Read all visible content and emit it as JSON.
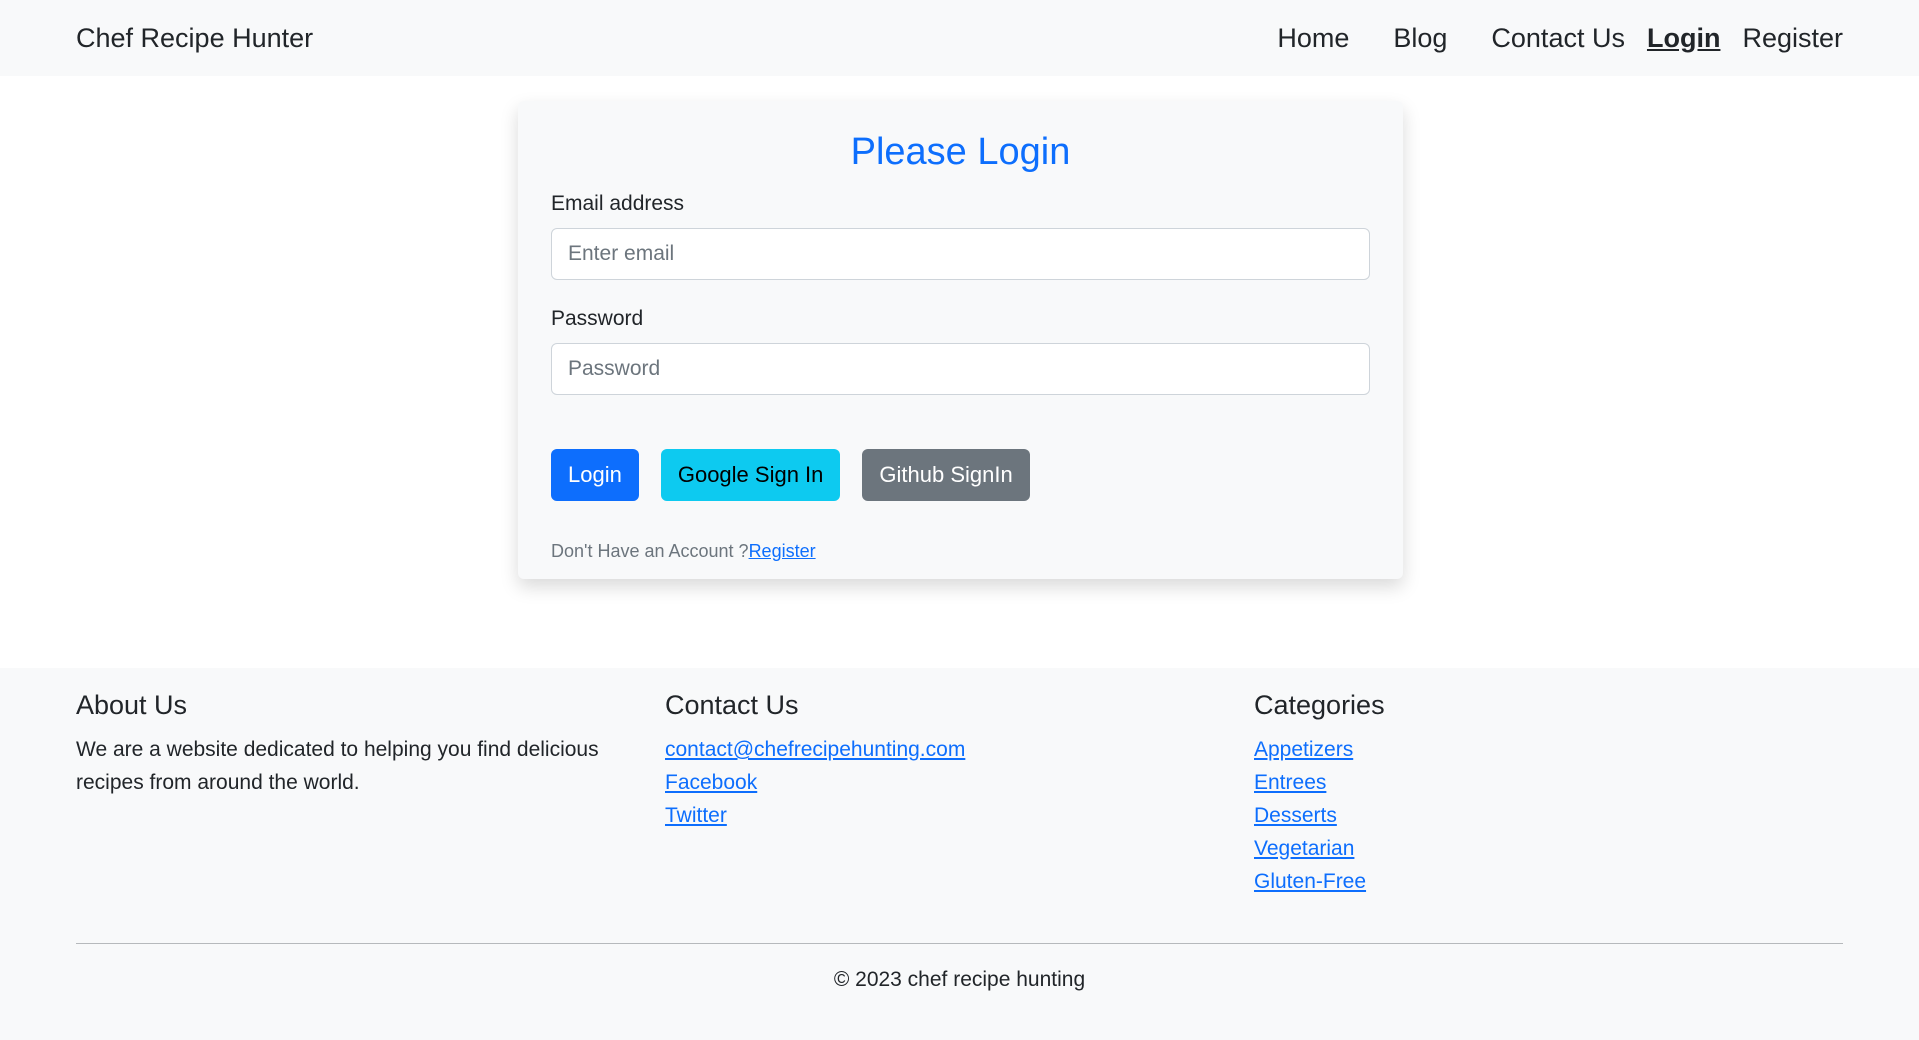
{
  "navbar": {
    "brand": "Chef Recipe Hunter",
    "links": [
      "Home",
      "Blog",
      "Contact Us",
      "Login",
      "Register"
    ]
  },
  "login_card": {
    "title": "Please Login",
    "email_label": "Email address",
    "email_placeholder": "Enter email",
    "password_label": "Password",
    "password_placeholder": "Password",
    "buttons": {
      "login": "Login",
      "google": "Google Sign In",
      "github": "Github SignIn"
    },
    "account_prompt": "Don't Have an Account ?",
    "register_link": "Register"
  },
  "footer": {
    "about": {
      "heading": "About Us",
      "text": "We are a website dedicated to helping you find delicious recipes from around the world."
    },
    "contact": {
      "heading": "Contact Us",
      "links": [
        "contact@chefrecipehunting.com",
        "Facebook",
        "Twitter"
      ]
    },
    "categories": {
      "heading": "Categories",
      "links": [
        "Appetizers",
        "Entrees",
        "Desserts",
        "Vegetarian",
        "Gluten-Free"
      ]
    },
    "copyright": "© 2023 chef recipe hunting"
  },
  "colors": {
    "primary": "#0d6efd",
    "info": "#0dcaf0",
    "secondary": "#6c757d",
    "light_bg": "#f8f9fa"
  }
}
